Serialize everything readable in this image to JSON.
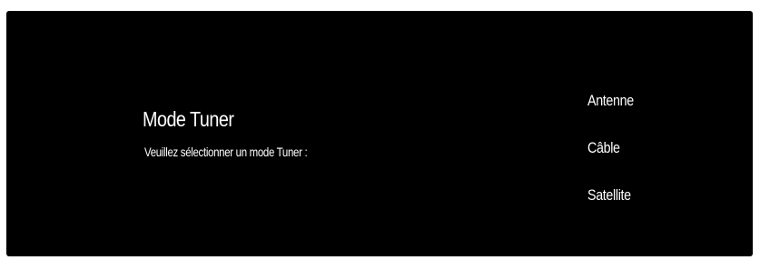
{
  "dialog": {
    "title": "Mode Tuner",
    "prompt": "Veuillez sélectionner un mode Tuner :"
  },
  "options": [
    {
      "label": "Antenne"
    },
    {
      "label": "Câble"
    },
    {
      "label": "Satellite"
    }
  ],
  "colors": {
    "background": "#000000",
    "text": "#ffffff"
  }
}
